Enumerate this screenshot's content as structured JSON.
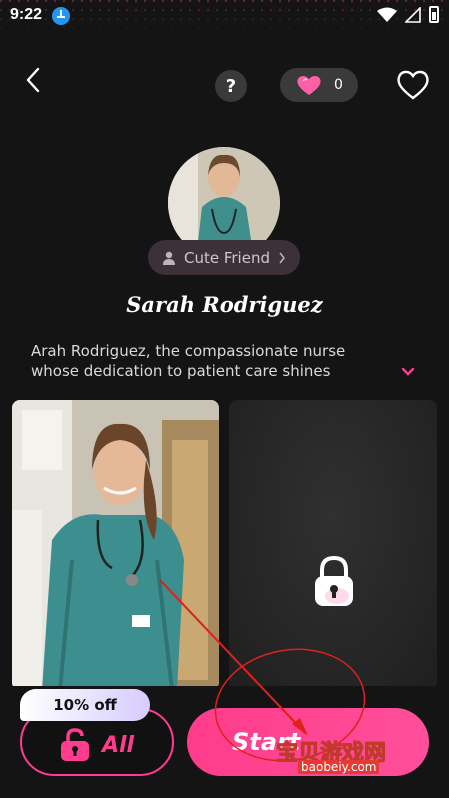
{
  "status_bar": {
    "time": "9:22"
  },
  "header": {
    "help_label": "?",
    "heart_count": "0"
  },
  "profile": {
    "relation": "Cute Friend",
    "name": "Sarah Rodriguez",
    "description": "Arah Rodriguez, the compassionate nurse whose dedication to patient care shines"
  },
  "bottom": {
    "discount": "10% off",
    "unlock_all_label": "All",
    "start_label": "Start"
  },
  "watermark": {
    "text": "宝贝游戏网",
    "url": "baobeiy.com"
  },
  "colors": {
    "accent": "#ff3d8e",
    "background": "#141414",
    "pill": "#3c3139"
  },
  "icons": [
    "download-icon",
    "wifi-icon",
    "signal-icon",
    "battery-icon",
    "back-icon",
    "help-icon",
    "heart-icon",
    "favorite-heart-icon",
    "person-icon",
    "chevron-right-icon",
    "chevron-down-icon",
    "lock-icon",
    "unlock-icon"
  ]
}
